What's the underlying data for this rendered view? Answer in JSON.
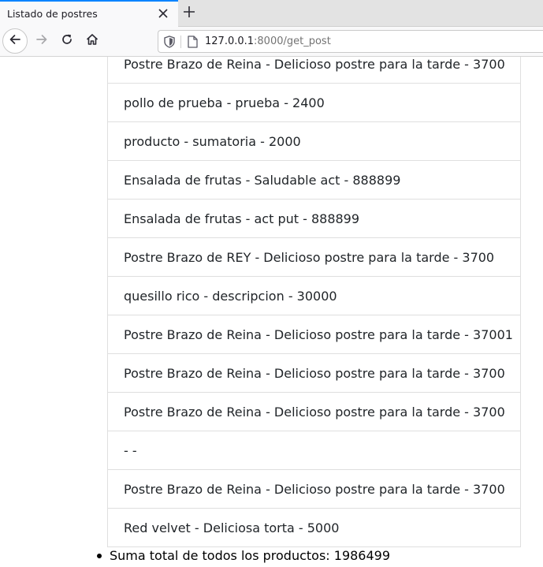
{
  "browser": {
    "tab_title": "Listado de postres",
    "url_host": "127.0.0.1",
    "url_path": ":8000/get_post",
    "icons": {
      "tab_close": "close-icon",
      "new_tab": "plus-icon",
      "back": "arrow-left-icon",
      "forward": "arrow-right-icon",
      "reload": "reload-icon",
      "home": "home-icon",
      "tracking": "shield-icon",
      "page": "page-icon"
    }
  },
  "products": [
    "Postre Brazo de Reina - Delicioso postre para la tarde - 3700",
    "pollo de prueba - prueba - 2400",
    "producto - sumatoria - 2000",
    "Ensalada de frutas - Saludable act - 888899",
    "Ensalada de frutas - act put - 888899",
    "Postre Brazo de REY - Delicioso postre para la tarde - 3700",
    "quesillo rico - descripcion - 30000",
    "Postre Brazo de Reina - Delicioso postre para la tarde - 37001",
    "Postre Brazo de Reina - Delicioso postre para la tarde - 3700",
    "Postre Brazo de Reina - Delicioso postre para la tarde - 3700",
    "- -",
    "Postre Brazo de Reina - Delicioso postre para la tarde - 3700",
    "Red velvet - Deliciosa torta - 5000"
  ],
  "total_text": "Suma total de todos los productos: 1986499"
}
